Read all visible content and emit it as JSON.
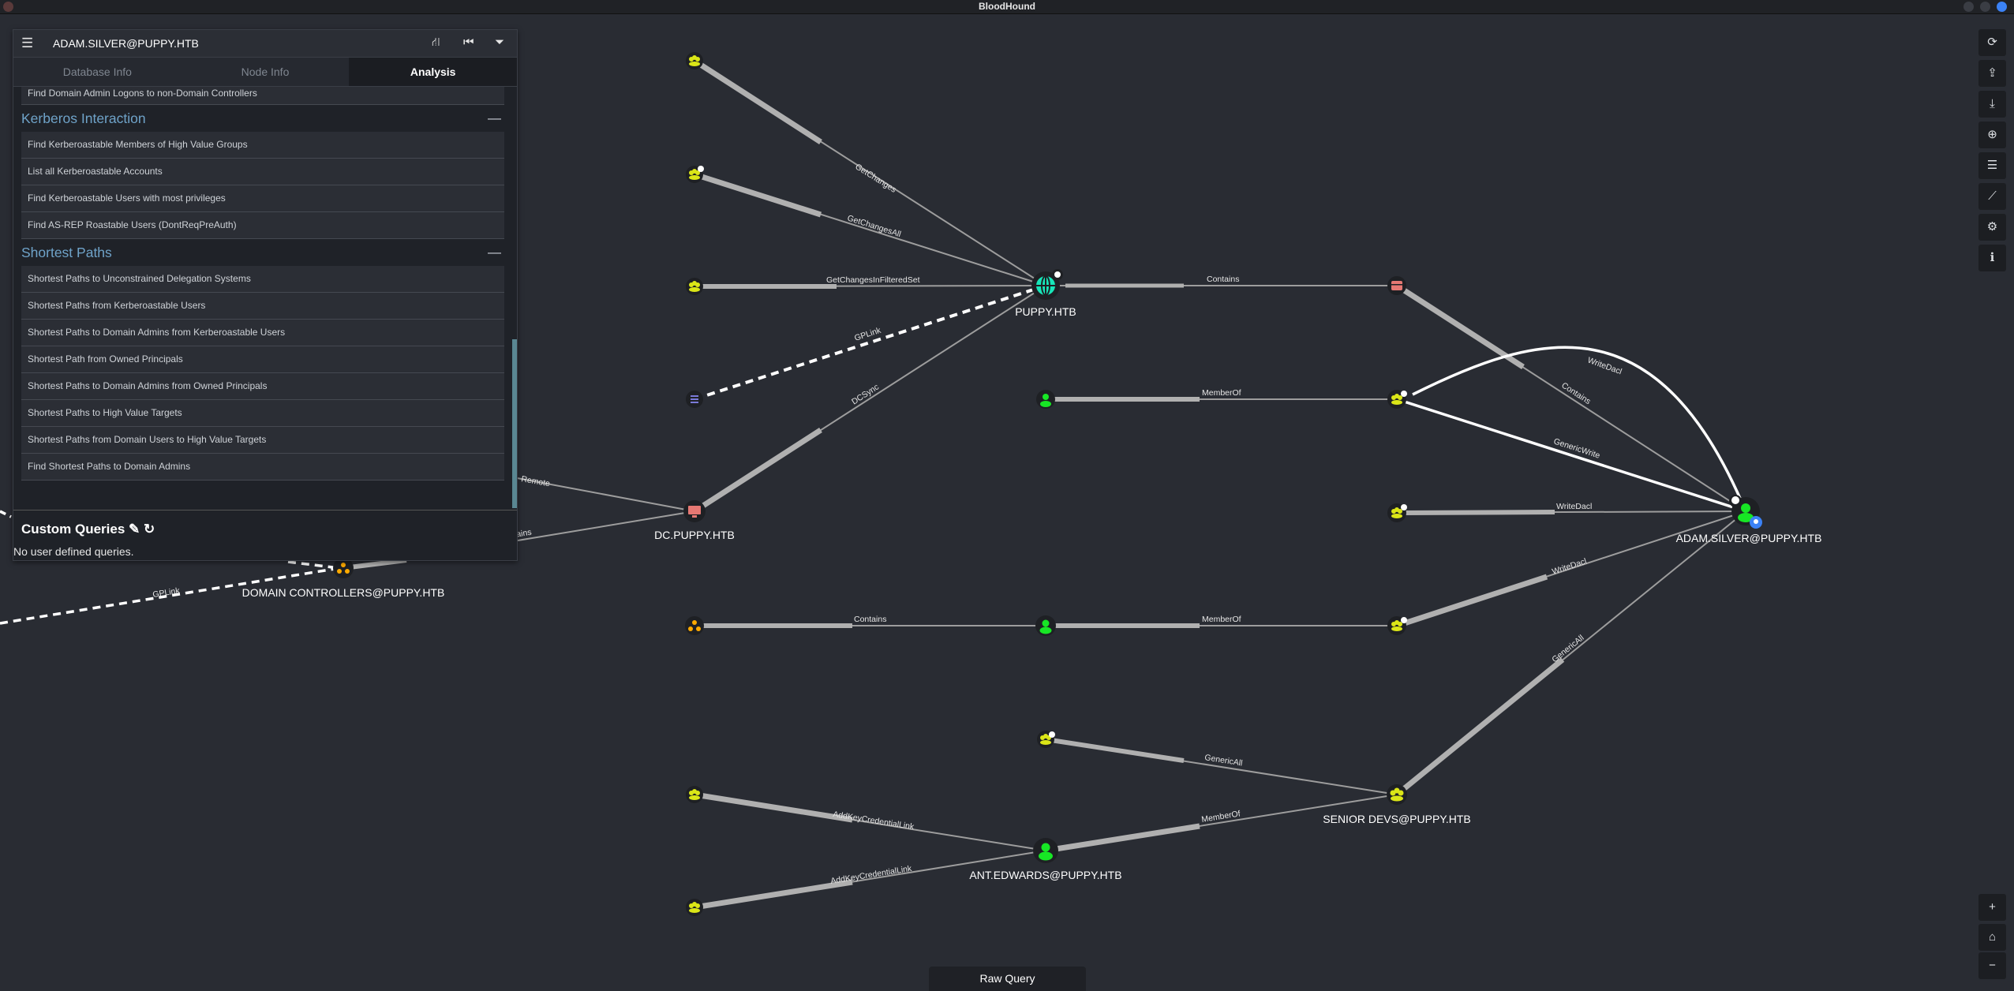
{
  "window": {
    "title": "BloodHound"
  },
  "search": {
    "value": "ADAM.SILVER@PUPPY.HTB"
  },
  "panel": {
    "tabs": [
      {
        "label": "Database Info"
      },
      {
        "label": "Node Info"
      },
      {
        "label": "Analysis"
      }
    ],
    "top_query": "Find Domain Admin Logons to non-Domain Controllers",
    "sections": [
      {
        "title": "Kerberos Interaction",
        "queries": [
          "Find Kerberoastable Members of High Value Groups",
          "List all Kerberoastable Accounts",
          "Find Kerberoastable Users with most privileges",
          "Find AS-REP Roastable Users (DontReqPreAuth)"
        ]
      },
      {
        "title": "Shortest Paths",
        "queries": [
          "Shortest Paths to Unconstrained Delegation Systems",
          "Shortest Paths from Kerberoastable Users",
          "Shortest Paths to Domain Admins from Kerberoastable Users",
          "Shortest Path from Owned Principals",
          "Shortest Paths to Domain Admins from Owned Principals",
          "Shortest Paths to High Value Targets",
          "Shortest Paths from Domain Users to High Value Targets",
          "Find Shortest Paths to Domain Admins"
        ]
      }
    ],
    "custom_queries": {
      "title": "Custom Queries",
      "empty_text": "No user defined queries."
    }
  },
  "raw_query": {
    "label": "Raw Query"
  },
  "graph": {
    "node_labels": {
      "puppy": "PUPPY.HTB",
      "dc": "DC.PUPPY.HTB",
      "domain_controllers": "DOMAIN CONTROLLERS@PUPPY.HTB",
      "adam": "ADAM.SILVER@PUPPY.HTB",
      "senior_devs": "SENIOR DEVS@PUPPY.HTB",
      "ant_edwards": "ANT.EDWARDS@PUPPY.HTB"
    },
    "edge_labels": {
      "getchanges": "GetChanges",
      "getchangesall": "GetChangesAll",
      "getchangesinfiltered": "GetChangesInFilteredSet",
      "gplink_top": "GPLink",
      "dcsync": "DCSync",
      "contains_puppy": "Contains",
      "memberof_top": "MemberOf",
      "writedacl_arc": "WriteDacl",
      "contains_ou": "Contains",
      "genericwrite": "GenericWrite",
      "writedacl_mid": "WriteDacl",
      "writedacl_low": "WriteDacl",
      "contains_low": "Contains",
      "memberof_low": "MemberOf",
      "genericall_adam": "GenericAll",
      "genericall_sd": "GenericAll",
      "memberof_ant": "MemberOf",
      "addkey_1": "AddKeyCredentialLink",
      "addkey_2": "AddKeyCredentialLink",
      "gplink_dcs": "GPLink",
      "remote_partial": "Remote",
      "contains_partial": "tains"
    }
  },
  "colors": {
    "user": "#17e625",
    "group": "#dbe617",
    "computer": "#e67873",
    "domain": "#17e6b9",
    "ou": "#ffaa00",
    "gpo": "#998e4c"
  }
}
